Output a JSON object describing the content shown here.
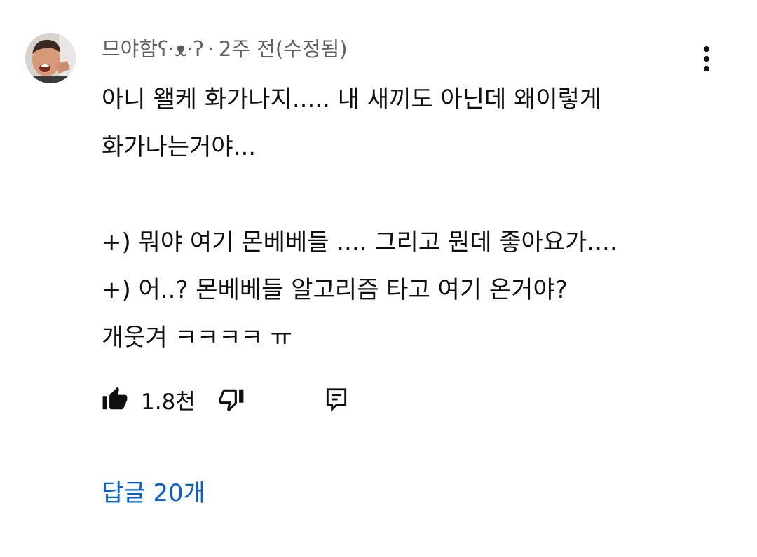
{
  "comment": {
    "author": "므야함ʕ·ᴥ·ʔ",
    "separator": "·",
    "timestamp": "2주 전(수정됨)",
    "lines": [
      "아니 왤케 화가나지..... 내 새끼도 아닌데 왜이렇게",
      "화가나는거야...",
      "",
      "+) 뭐야 여기 몬베베들 .... 그리고 뭔데 좋아요가....",
      "+) 어..? 몬베베들 알고리즘 타고 여기 온거야?",
      "개웃겨 ㅋㅋㅋㅋ ㅠ"
    ]
  },
  "actions": {
    "like_count": "1.8천",
    "like_icon": "thumbs-up-filled-icon",
    "dislike_icon": "thumbs-down-outline-icon",
    "reply_icon": "comment-reply-icon",
    "more_icon": "more-vertical-icon"
  },
  "replies": {
    "label": "답글 20개"
  },
  "colors": {
    "text_primary": "#0f0f0f",
    "text_secondary": "#606060",
    "link": "#065fd4",
    "background": "#ffffff"
  }
}
